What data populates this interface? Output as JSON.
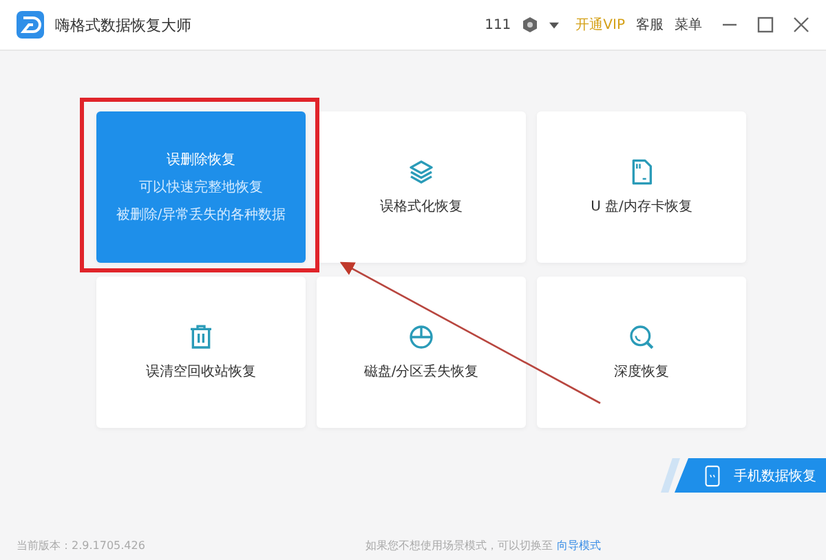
{
  "window": {
    "title": "嗨格式数据恢复大师",
    "user_id": "111",
    "vip_link": "开通VIP",
    "service": "客服",
    "menu": "菜单"
  },
  "cards": [
    {
      "kind": "featured",
      "title": "误删除恢复",
      "lines": [
        "可以快速完整地恢复",
        "被删除/异常丢失的各种数据"
      ],
      "highlighted": true
    },
    {
      "kind": "layers",
      "title": "误格式化恢复",
      "highlighted": false
    },
    {
      "kind": "sdcard",
      "title": "U 盘/内存卡恢复",
      "highlighted": false
    },
    {
      "kind": "trash",
      "title": "误清空回收站恢复",
      "highlighted": false
    },
    {
      "kind": "pie",
      "title": "磁盘/分区丢失恢复",
      "highlighted": false
    },
    {
      "kind": "search",
      "title": "深度恢复",
      "highlighted": false
    }
  ],
  "mobile_button": "手机数据恢复",
  "footer": {
    "version": "当前版本：2.9.1705.426",
    "hint": "如果您不想使用场景模式，可以切换至",
    "link": "向导模式"
  }
}
